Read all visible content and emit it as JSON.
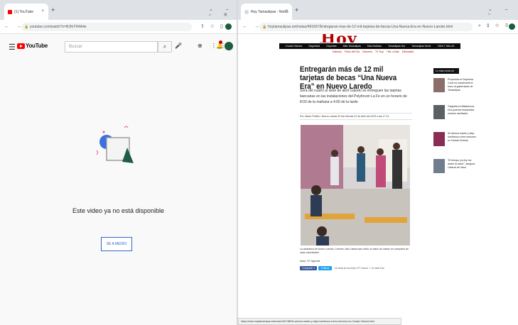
{
  "left_window": {
    "tab_title": "(1) YouTube",
    "url": "youtube.com/watch?v=BJfnTR4A4e",
    "youtube": {
      "search_placeholder": "Buscar",
      "logo_text": "YouTube",
      "unavailable_text": "Este video ya no está disponible",
      "learn_more_label": "SE A MEDIO"
    }
  },
  "right_window": {
    "tab_title": "Hoy Tamaulipas - Noticias en Tam",
    "url": "hoytamaulipas.net/notas/491667/Entregaran-mas-de-12-mil-tarjetas-de-becas-Una-Nueva-Era-en-Nuevo-Laredo.html",
    "masthead": "Hoy Tam",
    "nav_items": [
      "Ciudad Victoria",
      "Seguridad",
      "Deportes",
      "Más Tamaulipas",
      "Más Noticias",
      "Tamaulipas Sur",
      "Tamaulipas Norte",
      "VIDA Y SALUD"
    ],
    "subnav_items": [
      "Galerías",
      "Fotos del Día",
      "Cartones",
      "TV Hoy",
      "+Ms. a Mas",
      "Editoriales"
    ],
    "article": {
      "headline": "Entregarán más de 12 mil tarjetas de becas “Una Nueva Era” en Nuevo Laredo",
      "lead": "Será del cuatro al siete de abril cuando se entreguen las tarjetas bancarias en las instalaciones del Polyforum La Fe en un horario de 8:00 de la mañana a 4:00 de la tarde",
      "byline": "Por: Mario Portillo / Nuevo Laredo El día Viernes 01 de Abril del 2022 a las 17:14",
      "caption": "La alcaldesa de Nuevo Laredo, Carmen Lilia Canturosas visitó un salón de clases en compañía de otras autoridades",
      "author": "Autor: HT Agencia",
      "share_fb": "Compartir 1",
      "share_tw": "Twittear",
      "read_count": "La Nota se ha leído 477 veces. 7 en este Día"
    },
    "sidebar": {
      "heading": "Lo más Leído en Tamaulipas",
      "items": [
        "Propuesta en Suprema Corte es mantenerle el fuero al gobernador de Tamaulipas",
        "Tragedia en Matamoros: Dos jóvenes empleados mueren arrollados",
        "Se ahorca madre y deja huérfanos a tres menores en Ciudad Victoria",
        "“El tiempo y la ley me darán la razón”, asegura Cabeza de Vaca"
      ]
    },
    "status_url": "https://www.hoytamaulipas.net/notas/491788/Se-ahorca-madre-y-deja-huerfanos-a-tres-menores-en-Ciudad-Victoria.html"
  }
}
